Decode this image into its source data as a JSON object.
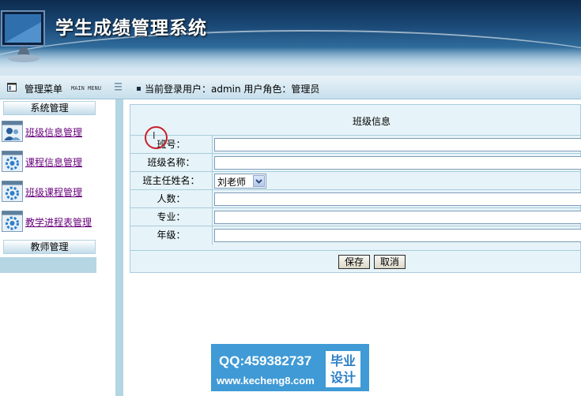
{
  "header": {
    "title": "学生成绩管理系统"
  },
  "menubar": {
    "title": "管理菜单",
    "subtitle": "MAIN MENU",
    "user_info": "当前登录用户：admin 用户角色：管理员"
  },
  "sidebar": {
    "sections": [
      {
        "heading": "系统管理"
      },
      {
        "heading": "教师管理"
      }
    ],
    "items": [
      {
        "label": "班级信息管理",
        "icon": "people-icon"
      },
      {
        "label": "课程信息管理",
        "icon": "gear-icon"
      },
      {
        "label": "班级课程管理",
        "icon": "gear-icon"
      },
      {
        "label": "教学进程表管理",
        "icon": "gear-icon"
      }
    ]
  },
  "form": {
    "caption": "班级信息",
    "fields": [
      {
        "label": "班号：",
        "value": ""
      },
      {
        "label": "班级名称：",
        "value": ""
      },
      {
        "label": "班主任姓名：",
        "value": "刘老师"
      },
      {
        "label": "人数：",
        "value": ""
      },
      {
        "label": "专业：",
        "value": ""
      },
      {
        "label": "年级：",
        "value": ""
      }
    ],
    "save_label": "保存",
    "cancel_label": "取消"
  },
  "watermark": {
    "qq": "QQ:459382737",
    "url": "www.kecheng8.com",
    "badge_line1": "毕业",
    "badge_line2": "设计"
  },
  "colors": {
    "header_dark": "#0d2b4e",
    "link_purple": "#67007a",
    "form_bg": "#e6f3f8",
    "watermark_blue": "#3f9ad6"
  }
}
